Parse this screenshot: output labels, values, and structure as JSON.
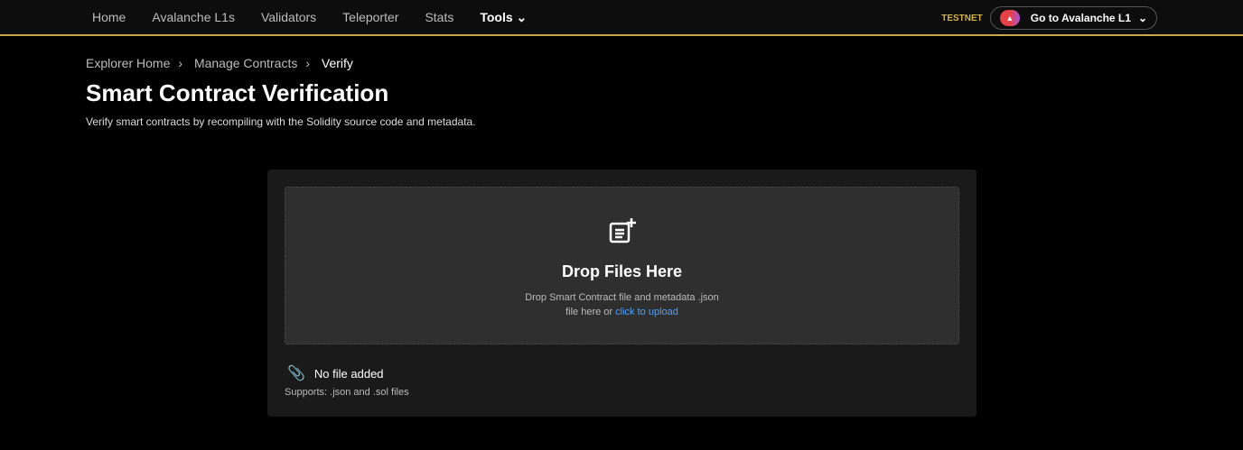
{
  "nav": {
    "items": [
      "Home",
      "Avalanche L1s",
      "Validators",
      "Teleporter",
      "Stats",
      "Tools"
    ],
    "network": "TESTNET",
    "goto": "Go to Avalanche L1"
  },
  "breadcrumb": [
    "Explorer Home",
    "Manage Contracts",
    "Verify"
  ],
  "title": "Smart Contract Verification",
  "description": "Verify smart contracts by recompiling with the Solidity source code and metadata.",
  "drop": {
    "title": "Drop Files Here",
    "line1": "Drop Smart Contract file and metadata .json",
    "line2": "file here or",
    "link": "click to upload"
  },
  "file_status": "No file added",
  "supports": "Supports: .json and .sol files"
}
